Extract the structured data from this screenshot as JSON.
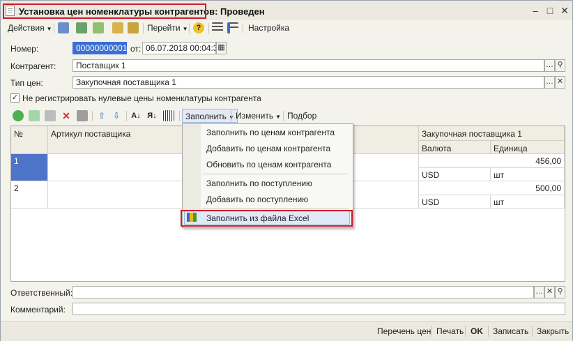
{
  "window": {
    "title": "Установка цен номенклатуры контрагентов: Проведен"
  },
  "toolbar": {
    "actions_label": "Действия",
    "goto_label": "Перейти",
    "help_label": "?",
    "settings_label": "Настройка"
  },
  "form": {
    "number_label": "Номер:",
    "number_value": "00000000001",
    "date_label": "от:",
    "date_value": "06.07.2018 00:04:34",
    "counterparty_label": "Контрагент:",
    "counterparty_value": "Поставщик 1",
    "price_type_label": "Тип цен:",
    "price_type_value": "Закупочная поставщика 1",
    "checkbox_label": "Не регистрировать нулевые цены номенклатуры контрагента",
    "checkbox_checked": true,
    "responsible_label": "Ответственный:",
    "responsible_value": "",
    "comment_label": "Комментарий:",
    "comment_value": ""
  },
  "table_toolbar": {
    "fill_label": "Заполнить",
    "change_label": "Изменить",
    "selection_label": "Подбор"
  },
  "table": {
    "headers": {
      "num": "№",
      "article": "Артикул поставщика",
      "group": "Закупочная поставщика 1",
      "currency": "Валюта",
      "unit": "Единица"
    },
    "rows": [
      {
        "num": "1",
        "price": "456,00",
        "currency": "USD",
        "unit": "шт"
      },
      {
        "num": "2",
        "price": "500,00",
        "currency": "USD",
        "unit": "шт"
      }
    ]
  },
  "fill_menu": {
    "items": [
      "Заполнить по ценам контрагента",
      "Добавить по ценам контрагента",
      "Обновить по ценам контрагента",
      "Заполнить по поступлению",
      "Добавить по поступлению",
      "Заполнить из файла Excel"
    ]
  },
  "footer": {
    "price_list": "Перечень цен",
    "print": "Печать",
    "ok": "OK",
    "save": "Записать",
    "close": "Закрыть"
  },
  "colors": {
    "highlight_red": "#d0192b",
    "selection_blue": "#4d74c8"
  }
}
